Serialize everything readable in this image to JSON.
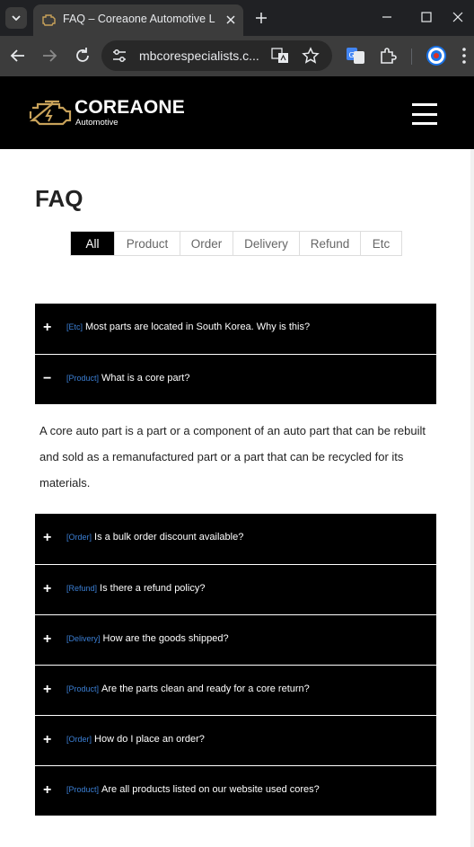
{
  "browser": {
    "tab_title": "FAQ – Coreaone Automotive L",
    "url": "mbcorespecialists.c...",
    "icons": [
      "chevron-down-icon",
      "close-icon",
      "plus-icon",
      "minimize-icon",
      "maximize-icon",
      "back-arrow-icon",
      "forward-arrow-icon",
      "reload-icon",
      "site-info-icon",
      "translate-icon",
      "star-icon",
      "extensions-icon",
      "profile-icon",
      "more-vertical-icon"
    ]
  },
  "header": {
    "brand_name": "COREAONE",
    "brand_sub": "Automotive",
    "colors": {
      "background": "#000000",
      "logo_accent": "#c8a25a"
    }
  },
  "page": {
    "title": "FAQ",
    "filters": [
      {
        "label": "All",
        "active": true
      },
      {
        "label": "Product",
        "active": false
      },
      {
        "label": "Order",
        "active": false
      },
      {
        "label": "Delivery",
        "active": false
      },
      {
        "label": "Refund",
        "active": false
      },
      {
        "label": "Etc",
        "active": false
      }
    ],
    "faqs": [
      {
        "category": "[Etc]",
        "question": "Most parts are located in South Korea. Why is this?",
        "expanded": false,
        "toggle": "+"
      },
      {
        "category": "[Product]",
        "question": "What is a core part?",
        "expanded": true,
        "toggle": "−",
        "answer": "A core auto part is a part or a component of an auto part that can be rebuilt and sold as a remanufactured part or a part that can be recycled for its materials."
      },
      {
        "category": "[Order]",
        "question": "Is a bulk order discount available?",
        "expanded": false,
        "toggle": "+"
      },
      {
        "category": "[Refund]",
        "question": "Is there a refund policy?",
        "expanded": false,
        "toggle": "+"
      },
      {
        "category": "[Delivery]",
        "question": "How are the goods shipped?",
        "expanded": false,
        "toggle": "+"
      },
      {
        "category": "[Product]",
        "question": "Are the parts clean and ready for a core return?",
        "expanded": false,
        "toggle": "+"
      },
      {
        "category": "[Order]",
        "question": "How do I place an order?",
        "expanded": false,
        "toggle": "+"
      },
      {
        "category": "[Product]",
        "question": "Are all products listed on our website used cores?",
        "expanded": false,
        "toggle": "+"
      }
    ],
    "colors": {
      "faq_background": "#000000",
      "category_label": "#3b7fd4",
      "active_filter": "#000000"
    }
  }
}
